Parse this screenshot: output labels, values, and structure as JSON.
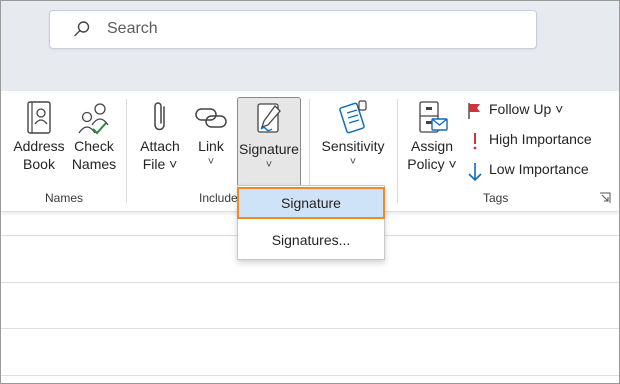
{
  "search": {
    "placeholder": "Search"
  },
  "ribbon": {
    "address_book": {
      "line1": "Address",
      "line2": "Book"
    },
    "check_names": {
      "line1": "Check",
      "line2": "Names"
    },
    "attach_file": {
      "line1": "Attach",
      "line2": "File ˅"
    },
    "link": {
      "line1": "Link",
      "line2": "˅"
    },
    "signature": {
      "line1": "Signature",
      "line2": "˅"
    },
    "sensitivity": {
      "line1": "Sensitivity",
      "line2": "˅"
    },
    "assign_policy": {
      "line1": "Assign",
      "line2": "Policy ˅"
    },
    "follow_up": "Follow Up ˅",
    "high_importance": "High Importance",
    "low_importance": "Low Importance",
    "groups": {
      "names": "Names",
      "include": "Include",
      "tags": "Tags"
    }
  },
  "signature_menu": {
    "item1": "Signature",
    "item2": "Signatures..."
  },
  "colors": {
    "flag": "#d13438",
    "importance_high": "#d13438",
    "importance_low": "#0f6cbd",
    "selection": "#cfe3f8",
    "focus_outline": "#f08a24"
  }
}
